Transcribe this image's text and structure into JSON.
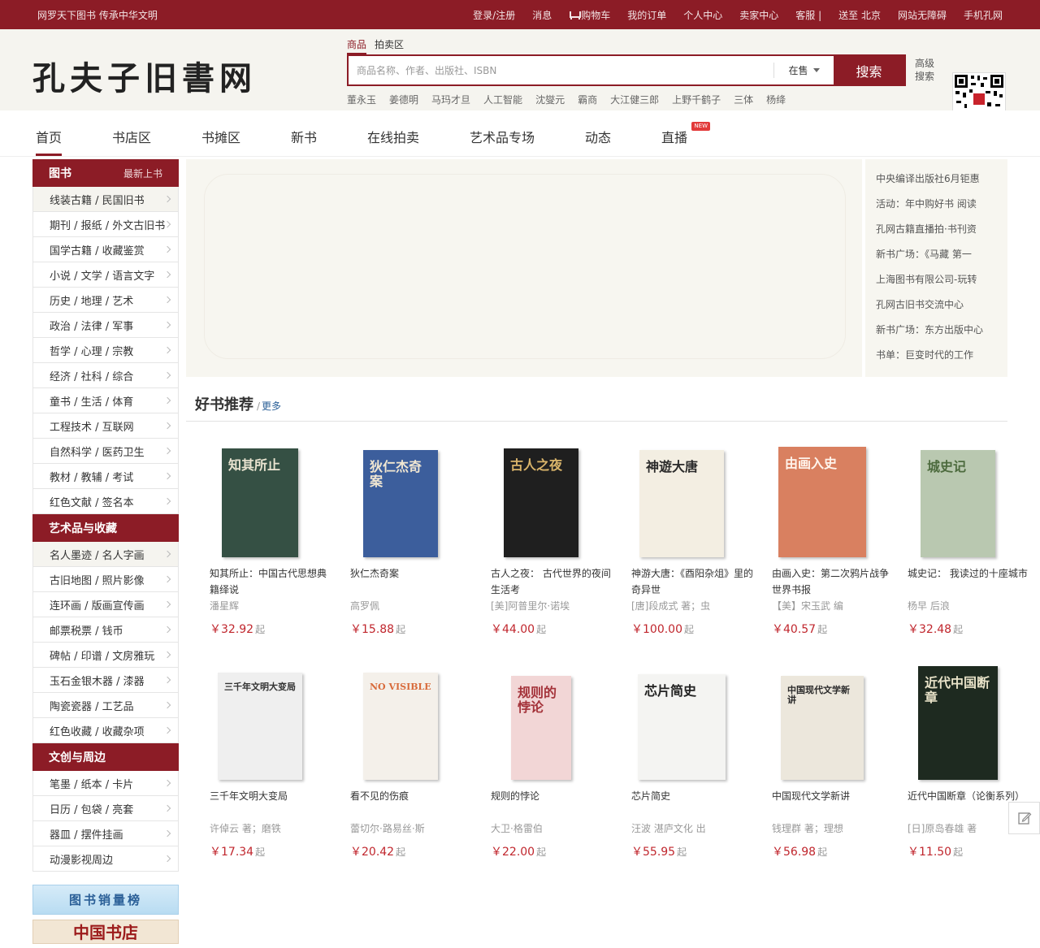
{
  "topbar": {
    "slogan": "网罗天下图书  传承中华文明",
    "links": [
      "登录/注册",
      "消息",
      "购物车",
      "我的订单",
      "个人中心",
      "卖家中心",
      "客服 |",
      "送至 北京",
      "网站无障碍",
      "手机孔网"
    ]
  },
  "header": {
    "logo": "孔夫子旧書网",
    "search_tabs": [
      "商品",
      "拍卖区"
    ],
    "search_placeholder": "商品名称、作者、出版社、ISBN",
    "search_scope": "在售",
    "search_button": "搜索",
    "advanced_search": "高级搜索",
    "hot_words": [
      "董永玉",
      "姜德明",
      "马玛才旦",
      "人工智能",
      "沈燮元",
      "霸商",
      "大江健三郎",
      "上野千鹤子",
      "三体",
      "杨绛"
    ]
  },
  "nav": {
    "items": [
      "首页",
      "书店区",
      "书摊区",
      "新书",
      "在线拍卖",
      "艺术品专场",
      "动态",
      "直播"
    ],
    "new_badge": "NEW"
  },
  "sidebar": {
    "books": {
      "title": "图书",
      "sub": "最新上书",
      "items": [
        "线装古籍 / 民国旧书",
        "期刊 / 报纸 / 外文古旧书",
        "国学古籍 / 收藏鉴赏",
        "小说 / 文学 / 语言文字",
        "历史 / 地理 / 艺术",
        "政治 / 法律 / 军事",
        "哲学 / 心理 / 宗教",
        "经济 / 社科 / 综合",
        "童书 / 生活 / 体育",
        "工程技术 / 互联网",
        "自然科学 / 医药卫生",
        "教材 / 教辅 / 考试",
        "红色文献 / 签名本"
      ]
    },
    "art": {
      "title": "艺术品与收藏",
      "items": [
        "名人墨迹 / 名人字画",
        "古旧地图 / 照片影像",
        "连环画 / 版画宣传画",
        "邮票税票 / 钱币",
        "碑帖 / 印谱 / 文房雅玩",
        "玉石金银木器 / 漆器",
        "陶瓷瓷器 / 工艺品",
        "红色收藏 / 收藏杂项"
      ]
    },
    "culture": {
      "title": "文创与周边",
      "items": [
        "笔墨 / 纸本 / 卡片",
        "日历 / 包袋 / 亮套",
        "器皿 / 摆件挂画",
        "动漫影视周边"
      ]
    },
    "banner1": "图书销量榜",
    "banner2": "中国书店"
  },
  "news": [
    "中央编译出版社6月钜惠",
    "活动：年中购好书 阅读",
    "孔网古籍直播拍·书刊资",
    "新书广场：《马藏 第一",
    "上海图书有限公司-玩转",
    "孔网古旧书交流中心",
    "新书广场：东方出版中心",
    "书单：巨变时代的工作"
  ],
  "recommend": {
    "title": "好书推荐",
    "more": "更多",
    "price_suffix": "起",
    "books": [
      {
        "title": "知其所止：中国古代思想典籍绎说",
        "author": "潘星辉",
        "price": "￥32.92",
        "cover_text": "知其所止",
        "cover_bg": "#355044",
        "cover_fg": "#e9e3d0"
      },
      {
        "title": "狄仁杰奇案",
        "author": "高罗佩",
        "price": "￥15.88",
        "cover_text": "狄仁杰奇案",
        "cover_bg": "#3c5e9c",
        "cover_fg": "#f1e7d2"
      },
      {
        "title": "古人之夜： 古代世界的夜间生活考",
        "author": "[美]阿普里尔·诺埃",
        "price": "￥44.00",
        "cover_text": "古人之夜",
        "cover_bg": "#1f1f1f",
        "cover_fg": "#d9b46a"
      },
      {
        "title": "神游大唐：《酉阳杂俎》里的奇异世",
        "author": "[唐]段成式 著；虫",
        "price": "￥100.00",
        "cover_text": "神遊大唐",
        "cover_bg": "#f3eee2",
        "cover_fg": "#2a2a2a"
      },
      {
        "title": "由画入史：第二次鸦片战争世界书报",
        "author": "【美】宋玉武 编",
        "price": "￥40.57",
        "cover_text": "由画入史",
        "cover_bg": "#d98060",
        "cover_fg": "#fff4ec"
      },
      {
        "title": "城史记： 我读过的十座城市",
        "author": "杨早 后浪",
        "price": "￥32.48",
        "cover_text": "城史记",
        "cover_bg": "#b9c8b0",
        "cover_fg": "#4d6b3e"
      },
      {
        "title": "三千年文明大变局",
        "author": "许倬云 著；磨铁",
        "price": "￥17.34",
        "cover_text": "三千年文明大变局",
        "cover_bg": "#efefef",
        "cover_fg": "#333333"
      },
      {
        "title": "看不见的伤痕",
        "author": "蕾切尔·路易丝·斯",
        "price": "￥20.42",
        "cover_text": "NO VISIBLE",
        "cover_bg": "#f4f0ea",
        "cover_fg": "#d86a3a"
      },
      {
        "title": "规则的悖论",
        "author": "大卫·格雷伯",
        "price": "￥22.00",
        "cover_text": "规则的悖论",
        "cover_bg": "#f2d6d6",
        "cover_fg": "#a4333a"
      },
      {
        "title": "芯片简史",
        "author": "汪波 湛庐文化 出",
        "price": "￥55.95",
        "cover_text": "芯片简史",
        "cover_bg": "#f4f4f2",
        "cover_fg": "#222222"
      },
      {
        "title": "中国现代文学新讲",
        "author": "钱理群 著；理想",
        "price": "￥56.98",
        "cover_text": "中国现代文学新讲",
        "cover_bg": "#ece7dc",
        "cover_fg": "#2a2a2a"
      },
      {
        "title": "近代中国断章（论衡系列）",
        "author": "[日]原岛春雄 著",
        "price": "￥11.50",
        "cover_text": "近代中国断章",
        "cover_bg": "#1e2a20",
        "cover_fg": "#e8e2c8"
      }
    ]
  }
}
